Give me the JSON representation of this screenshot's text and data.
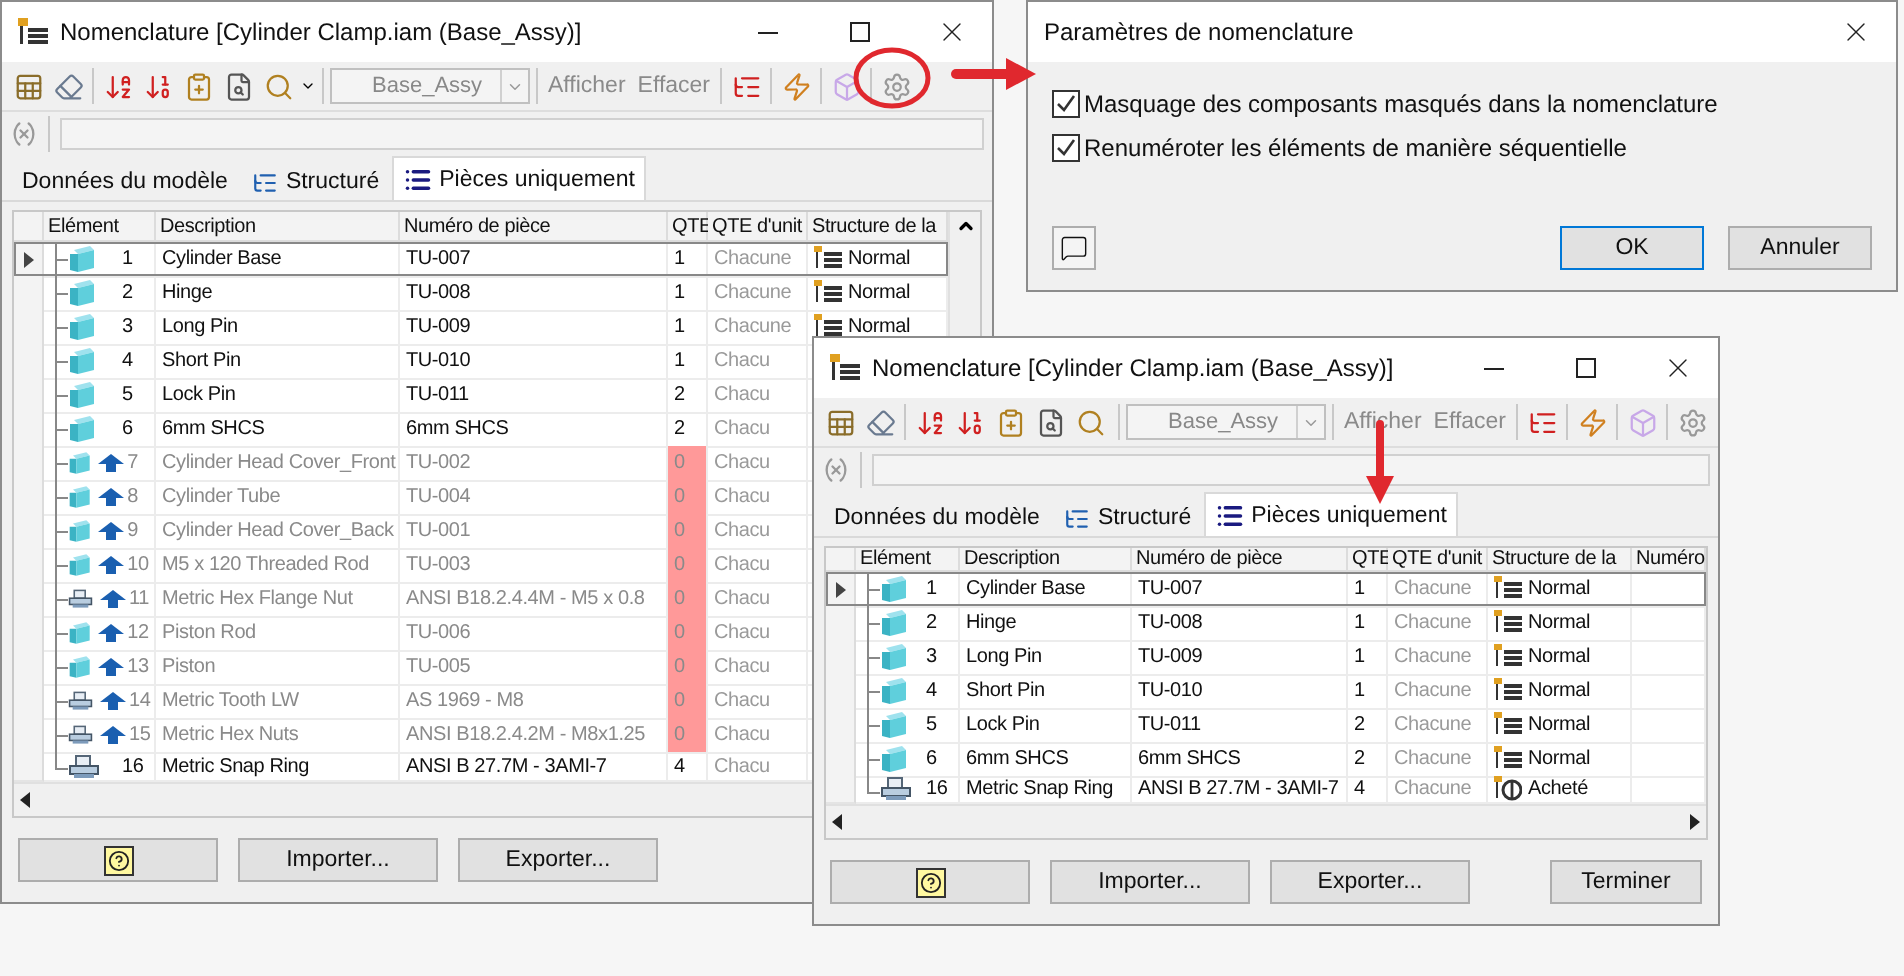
{
  "bom_windows": [
    {
      "title": "Nomenclature [Cylinder Clamp.iam (Base_Assy)]",
      "combo": {
        "value": "Base_Assy",
        "disabled": true
      },
      "toolbar_texts": [
        {
          "label": "Afficher",
          "disabled": true
        },
        {
          "label": "Effacer",
          "disabled": true
        }
      ],
      "tabs": [
        {
          "label": "Données du modèle",
          "kind": "plain",
          "selected": false
        },
        {
          "label": "Structuré",
          "kind": "tree",
          "selected": false
        },
        {
          "label": "Pièces uniquement",
          "kind": "list",
          "selected": true
        }
      ],
      "columns": [
        "Elément",
        "Description",
        "Numéro de pièce",
        "QTE",
        "QTE d'unit",
        "Structure de la"
      ],
      "rows": [
        {
          "current": true,
          "kind": "part",
          "hidden": false,
          "number": "1",
          "description": "Cylinder Base",
          "part_number": "TU-007",
          "qty": "1",
          "unit": "Chacune",
          "structure": {
            "kind": "normal",
            "label": "Normal"
          }
        },
        {
          "current": false,
          "kind": "part",
          "hidden": false,
          "number": "2",
          "description": "Hinge",
          "part_number": "TU-008",
          "qty": "1",
          "unit": "Chacune",
          "structure": {
            "kind": "normal",
            "label": "Normal"
          }
        },
        {
          "current": false,
          "kind": "part",
          "hidden": false,
          "number": "3",
          "description": "Long Pin",
          "part_number": "TU-009",
          "qty": "1",
          "unit": "Chacune",
          "structure": {
            "kind": "normal",
            "label": "Normal"
          }
        },
        {
          "current": false,
          "kind": "part",
          "hidden": false,
          "number": "4",
          "description": "Short Pin",
          "part_number": "TU-010",
          "qty": "1",
          "unit": "Chacu"
        },
        {
          "current": false,
          "kind": "part",
          "hidden": false,
          "number": "5",
          "description": "Lock Pin",
          "part_number": "TU-011",
          "qty": "2",
          "unit": "Chacu"
        },
        {
          "current": false,
          "kind": "part",
          "hidden": false,
          "number": "6",
          "description": "6mm SHCS",
          "part_number": "6mm SHCS",
          "qty": "2",
          "unit": "Chacu"
        },
        {
          "current": false,
          "kind": "part",
          "hidden": true,
          "number": "7",
          "description": "Cylinder Head Cover_Front",
          "part_number": "TU-002",
          "qty": "0",
          "unit": "Chacu"
        },
        {
          "current": false,
          "kind": "part",
          "hidden": true,
          "number": "8",
          "description": "Cylinder Tube",
          "part_number": "TU-004",
          "qty": "0",
          "unit": "Chacu"
        },
        {
          "current": false,
          "kind": "part",
          "hidden": true,
          "number": "9",
          "description": "Cylinder Head Cover_Back",
          "part_number": "TU-001",
          "qty": "0",
          "unit": "Chacu"
        },
        {
          "current": false,
          "kind": "part",
          "hidden": true,
          "number": "10",
          "description": "M5 x 120 Threaded Rod",
          "part_number": "TU-003",
          "qty": "0",
          "unit": "Chacu"
        },
        {
          "current": false,
          "kind": "library",
          "hidden": true,
          "number": "11",
          "description": "Metric Hex Flange Nut",
          "part_number": "ANSI B18.2.4.4M - M5 x 0.8",
          "qty": "0",
          "unit": "Chacu"
        },
        {
          "current": false,
          "kind": "part",
          "hidden": true,
          "number": "12",
          "description": "Piston Rod",
          "part_number": "TU-006",
          "qty": "0",
          "unit": "Chacu"
        },
        {
          "current": false,
          "kind": "part",
          "hidden": true,
          "number": "13",
          "description": "Piston",
          "part_number": "TU-005",
          "qty": "0",
          "unit": "Chacu"
        },
        {
          "current": false,
          "kind": "library",
          "hidden": true,
          "number": "14",
          "description": "Metric Tooth LW",
          "part_number": "AS 1969 - M8",
          "qty": "0",
          "unit": "Chacu"
        },
        {
          "current": false,
          "kind": "library",
          "hidden": true,
          "number": "15",
          "description": "Metric Hex Nuts",
          "part_number": "ANSI B18.2.4.2M - M8x1.25",
          "qty": "0",
          "unit": "Chacu"
        },
        {
          "current": false,
          "kind": "library",
          "hidden": false,
          "number": "16",
          "description": "Metric Snap Ring",
          "part_number": "ANSI B 27.7M - 3AMI-7",
          "qty": "4",
          "unit": "Chacu"
        }
      ],
      "buttons": [
        {
          "kind": "help"
        },
        {
          "kind": "action",
          "label": "Importer..."
        },
        {
          "kind": "action",
          "label": "Exporter..."
        }
      ]
    },
    {
      "title": "Nomenclature [Cylinder Clamp.iam (Base_Assy)]",
      "combo": {
        "value": "Base_Assy",
        "disabled": true
      },
      "toolbar_texts": [
        {
          "label": "Afficher",
          "disabled": true
        },
        {
          "label": "Effacer",
          "disabled": true
        }
      ],
      "tabs": [
        {
          "label": "Données du modèle",
          "kind": "plain",
          "selected": false
        },
        {
          "label": "Structuré",
          "kind": "tree",
          "selected": false
        },
        {
          "label": "Pièces uniquement",
          "kind": "list",
          "selected": true
        }
      ],
      "columns": [
        "Elément",
        "Description",
        "Numéro de pièce",
        "QTE",
        "QTE d'unit",
        "Structure de la",
        "Numéro"
      ],
      "rows": [
        {
          "current": true,
          "kind": "part",
          "hidden": false,
          "number": "1",
          "description": "Cylinder Base",
          "part_number": "TU-007",
          "qty": "1",
          "unit": "Chacune",
          "structure": {
            "kind": "normal",
            "label": "Normal"
          }
        },
        {
          "current": false,
          "kind": "part",
          "hidden": false,
          "number": "2",
          "description": "Hinge",
          "part_number": "TU-008",
          "qty": "1",
          "unit": "Chacune",
          "structure": {
            "kind": "normal",
            "label": "Normal"
          }
        },
        {
          "current": false,
          "kind": "part",
          "hidden": false,
          "number": "3",
          "description": "Long Pin",
          "part_number": "TU-009",
          "qty": "1",
          "unit": "Chacune",
          "structure": {
            "kind": "normal",
            "label": "Normal"
          }
        },
        {
          "current": false,
          "kind": "part",
          "hidden": false,
          "number": "4",
          "description": "Short Pin",
          "part_number": "TU-010",
          "qty": "1",
          "unit": "Chacune",
          "structure": {
            "kind": "normal",
            "label": "Normal"
          }
        },
        {
          "current": false,
          "kind": "part",
          "hidden": false,
          "number": "5",
          "description": "Lock Pin",
          "part_number": "TU-011",
          "qty": "2",
          "unit": "Chacune",
          "structure": {
            "kind": "normal",
            "label": "Normal"
          }
        },
        {
          "current": false,
          "kind": "part",
          "hidden": false,
          "number": "6",
          "description": "6mm SHCS",
          "part_number": "6mm SHCS",
          "qty": "2",
          "unit": "Chacune",
          "structure": {
            "kind": "normal",
            "label": "Normal"
          }
        },
        {
          "current": false,
          "kind": "library",
          "hidden": false,
          "number": "16",
          "description": "Metric Snap Ring",
          "part_number": "ANSI B 27.7M - 3AMI-7",
          "qty": "4",
          "unit": "Chacune",
          "structure": {
            "kind": "purchased",
            "label": "Acheté"
          }
        }
      ],
      "buttons": [
        {
          "kind": "help"
        },
        {
          "kind": "action",
          "label": "Importer..."
        },
        {
          "kind": "action",
          "label": "Exporter..."
        },
        {
          "kind": "finish",
          "label": "Terminer"
        }
      ]
    }
  ],
  "settings_dialog": {
    "title": "Paramètres de nomenclature",
    "options": [
      {
        "label": "Masquage des composants masqués dans la nomenclature",
        "checked": true
      },
      {
        "label": "Renuméroter les éléments de manière séquentielle",
        "checked": true
      }
    ],
    "buttons": [
      {
        "kind": "help"
      },
      {
        "kind": "default",
        "label": "OK"
      },
      {
        "kind": "action",
        "label": "Annuler"
      }
    ]
  }
}
